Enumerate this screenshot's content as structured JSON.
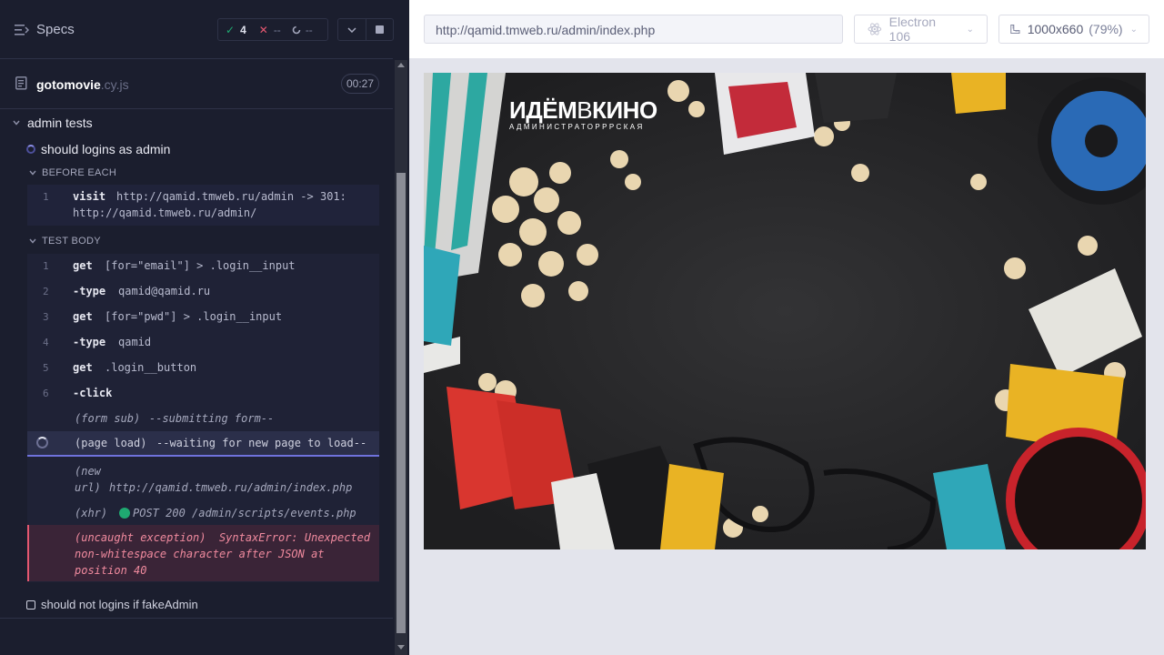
{
  "reporter": {
    "specs_label": "Specs",
    "stats": {
      "passed": "4",
      "failed": "--",
      "pending": "--"
    },
    "file": {
      "name": "gotomovie",
      "ext": ".cy.js",
      "duration": "00:27"
    },
    "suite_title": "admin tests",
    "tests": [
      {
        "title": "should logins as admin",
        "state": "running"
      },
      {
        "title": "should not logins if fakeAdmin",
        "state": "pending"
      }
    ],
    "before_each": {
      "title": "BEFORE EACH",
      "commands": [
        {
          "num": "1",
          "name": "visit",
          "message": "http://qamid.tmweb.ru/admin -> 301:",
          "message2": "http://qamid.tmweb.ru/admin/"
        }
      ]
    },
    "test_body": {
      "title": "TEST BODY",
      "commands": [
        {
          "num": "1",
          "name": "get",
          "message": "[for=\"email\"] > .login__input"
        },
        {
          "num": "2",
          "name": "-type",
          "message": "qamid@qamid.ru"
        },
        {
          "num": "3",
          "name": "get",
          "message": "[for=\"pwd\"] > .login__input"
        },
        {
          "num": "4",
          "name": "-type",
          "message": "qamid"
        },
        {
          "num": "5",
          "name": "get",
          "message": ".login__button"
        },
        {
          "num": "6",
          "name": "-click",
          "message": ""
        }
      ],
      "events": {
        "form_sub": {
          "label": "(form sub)",
          "message": "--submitting form--"
        },
        "page_load": {
          "label": "(page load)",
          "message": "--waiting for new page to load--"
        },
        "new_url": {
          "label1": "(new",
          "label2": "url)",
          "message": "http://qamid.tmweb.ru/admin/index.php"
        },
        "xhr": {
          "label": "(xhr)",
          "message": "POST 200 /admin/scripts/events.php"
        },
        "error": {
          "label": "(uncaught exception)",
          "message": "SyntaxError: Unexpected",
          "line2": "non-whitespace character after JSON at",
          "line3": "position 40"
        }
      }
    }
  },
  "aut": {
    "url": "http://qamid.tmweb.ru/admin/index.php",
    "browser": "Electron 106",
    "viewport": "1000x660",
    "scale": "(79%)",
    "page": {
      "logo_part1": "ИДЁМ",
      "logo_part2": "В",
      "logo_part3": "КИНО",
      "logo_sub": "АДМИНИСТРАТОРРРСКАЯ"
    }
  },
  "colors": {
    "pass": "#1fa971",
    "fail": "#e45770",
    "accent": "#6f72dc",
    "xhr_dot": "#1fa971"
  }
}
